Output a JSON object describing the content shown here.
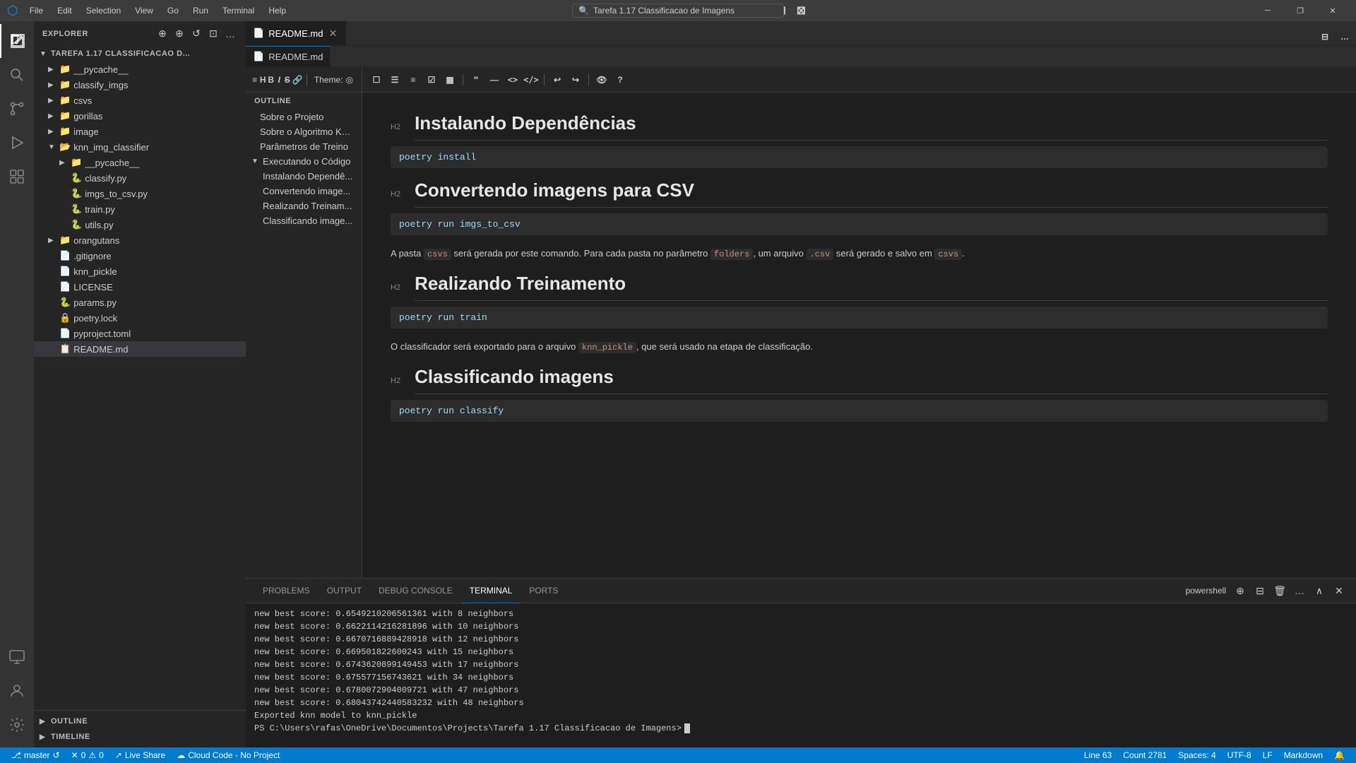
{
  "titleBar": {
    "appTitle": "Tarefa 1.17 Classificacao de Imagens",
    "menus": [
      "File",
      "Edit",
      "Selection",
      "View",
      "Go",
      "Run",
      "Terminal",
      "Help"
    ],
    "windowControls": [
      "─",
      "❐",
      "✕"
    ]
  },
  "activityBar": {
    "icons": [
      {
        "name": "explorer-icon",
        "symbol": "⎗",
        "active": true
      },
      {
        "name": "search-icon",
        "symbol": "🔍",
        "active": false
      },
      {
        "name": "source-control-icon",
        "symbol": "⎇",
        "active": false
      },
      {
        "name": "run-debug-icon",
        "symbol": "▶",
        "active": false
      },
      {
        "name": "extensions-icon",
        "symbol": "⊞",
        "active": false
      },
      {
        "name": "remote-explorer-icon",
        "symbol": "🖥",
        "active": false
      },
      {
        "name": "cloud-code-icon",
        "symbol": "☁",
        "active": false
      }
    ],
    "bottomIcons": [
      {
        "name": "accounts-icon",
        "symbol": "👤"
      },
      {
        "name": "settings-icon",
        "symbol": "⚙"
      }
    ]
  },
  "sidebar": {
    "title": "Explorer",
    "actions": [
      "⊕",
      "⊕",
      "↺",
      "⊡",
      "…"
    ],
    "rootLabel": "TAREFA 1.17 CLASSIFICACAO D...",
    "tree": [
      {
        "label": "__pycache__",
        "type": "folder",
        "indent": 1,
        "collapsed": true
      },
      {
        "label": "classify_imgs",
        "type": "folder",
        "indent": 1,
        "collapsed": true
      },
      {
        "label": "csvs",
        "type": "folder",
        "indent": 1,
        "collapsed": true
      },
      {
        "label": "gorillas",
        "type": "folder",
        "indent": 1,
        "collapsed": true,
        "hovered": true
      },
      {
        "label": "image",
        "type": "folder",
        "indent": 1,
        "collapsed": true
      },
      {
        "label": "knn_img_classifier",
        "type": "folder",
        "indent": 1,
        "collapsed": false
      },
      {
        "label": "__pycache__",
        "type": "folder",
        "indent": 2,
        "collapsed": true
      },
      {
        "label": "classify.py",
        "type": "file-py",
        "indent": 2
      },
      {
        "label": "imgs_to_csv.py",
        "type": "file-py",
        "indent": 2
      },
      {
        "label": "train.py",
        "type": "file-py",
        "indent": 2
      },
      {
        "label": "utils.py",
        "type": "file-py",
        "indent": 2
      },
      {
        "label": "orangutans",
        "type": "folder",
        "indent": 1,
        "collapsed": true
      },
      {
        "label": ".gitignore",
        "type": "file-txt",
        "indent": 1
      },
      {
        "label": "knn_pickle",
        "type": "file-txt",
        "indent": 1
      },
      {
        "label": "LICENSE",
        "type": "file-txt",
        "indent": 1
      },
      {
        "label": "params.py",
        "type": "file-py",
        "indent": 1
      },
      {
        "label": "poetry.lock",
        "type": "file-lock",
        "indent": 1
      },
      {
        "label": "pyproject.toml",
        "type": "file-toml",
        "indent": 1
      },
      {
        "label": "README.md",
        "type": "file-md",
        "indent": 1,
        "selected": true
      }
    ]
  },
  "tabs": [
    {
      "label": "README.md",
      "type": "md",
      "active": true,
      "icon": "📄"
    }
  ],
  "breadcrumb": {
    "items": [
      "README.md"
    ]
  },
  "mdToolbar": {
    "buttons": [
      "≡",
      "H",
      "B",
      "I",
      "—",
      "🔗",
      "⊠",
      "🖨",
      "⬆"
    ],
    "theme": "Theme:",
    "themeIcon": "◎",
    "rightButtons": [
      "☐",
      "☰",
      "☰",
      "☑",
      "▦",
      "\"",
      "—",
      "<>",
      "</>",
      "↩",
      "↪",
      "👁",
      "?"
    ]
  },
  "outline": {
    "header": "Outline",
    "items": [
      {
        "label": "Sobre o Projeto",
        "level": "root"
      },
      {
        "label": "Sobre o Algoritmo KNN",
        "level": "root"
      },
      {
        "label": "Parâmetros de Treino",
        "level": "root"
      },
      {
        "label": "Executando o Código",
        "level": "parent",
        "expanded": true
      },
      {
        "label": "Instalando Dependê...",
        "level": "child"
      },
      {
        "label": "Convertendo image...",
        "level": "child"
      },
      {
        "label": "Realizando Treinam...",
        "level": "child"
      },
      {
        "label": "Classificando image...",
        "level": "child"
      }
    ]
  },
  "markdown": {
    "sections": [
      {
        "type": "h2",
        "label": "H2",
        "text": "Instalando Dependências"
      },
      {
        "type": "code",
        "text": "poetry install"
      },
      {
        "type": "h2",
        "label": "H2",
        "text": "Convertendo imagens para CSV"
      },
      {
        "type": "code",
        "text": "poetry run imgs_to_csv"
      },
      {
        "type": "paragraph",
        "parts": [
          {
            "text": "A pasta ",
            "style": "normal"
          },
          {
            "text": "csvs",
            "style": "code"
          },
          {
            "text": " será gerada por este comando. Para cada pasta no parâmetro ",
            "style": "normal"
          },
          {
            "text": "folders",
            "style": "code"
          },
          {
            "text": ", um arquivo ",
            "style": "normal"
          },
          {
            "text": ".csv",
            "style": "code"
          },
          {
            "text": " será gerado e salvo em ",
            "style": "normal"
          },
          {
            "text": "csvs",
            "style": "code"
          },
          {
            "text": ".",
            "style": "normal"
          }
        ]
      },
      {
        "type": "h2",
        "label": "H2",
        "text": "Realizando Treinamento"
      },
      {
        "type": "code",
        "text": "poetry run train"
      },
      {
        "type": "paragraph",
        "parts": [
          {
            "text": "O classificador será exportado para o arquivo ",
            "style": "normal"
          },
          {
            "text": "knn_pickle",
            "style": "code"
          },
          {
            "text": ", que será usado na etapa de classificação.",
            "style": "normal"
          }
        ]
      },
      {
        "type": "h2",
        "label": "H2",
        "text": "Classificando imagens"
      },
      {
        "type": "code",
        "text": "poetry run classify"
      }
    ]
  },
  "terminal": {
    "tabs": [
      "PROBLEMS",
      "OUTPUT",
      "DEBUG CONSOLE",
      "TERMINAL",
      "PORTS"
    ],
    "activeTab": "TERMINAL",
    "shell": "powershell",
    "lines": [
      "new best score: 0.6549210206561361 with 8 neighbors",
      "new best score: 0.6622114216281896 with 10 neighbors",
      "new best score: 0.6670716889428918 with 12 neighbors",
      "new best score: 0.669501822600243 with 15 neighbors",
      "new best score: 0.6743620899149453 with 17 neighbors",
      "new best score: 0.675577156743621 with 34 neighbors",
      "new best score: 0.6780072904009721 with 47 neighbors",
      "new best score: 0.68043742440583232 with 48 neighbors",
      "Exported knn model to knn_pickle",
      "PS C:\\Users\\rafas\\OneDrive\\Documentos\\Projects\\Tarefa 1.17 Classificacao de Imagens>"
    ]
  },
  "statusBar": {
    "branch": "master",
    "syncIcon": "↺",
    "errors": "0",
    "warnings": "0",
    "liveShare": "Live Share",
    "cloudCode": "Cloud Code - No Project",
    "lineInfo": "Line 63",
    "countInfo": "Count 2781",
    "spacesLabel": "Spaces: 4",
    "encodingLabel": "UTF-8",
    "eolLabel": "LF",
    "languageLabel": "Markdown"
  }
}
